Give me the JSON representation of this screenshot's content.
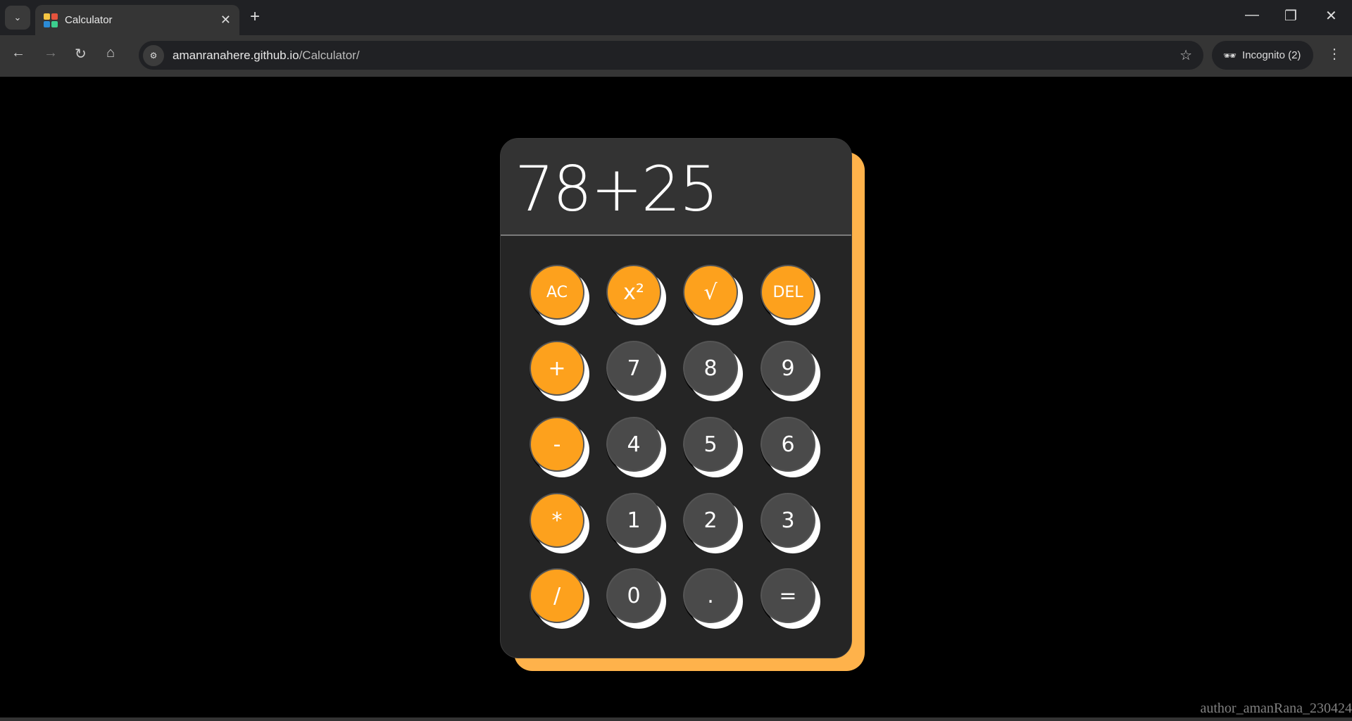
{
  "browser": {
    "tab_title": "Calculator",
    "url_host": "amanranahere.github.io",
    "url_path": "/Calculator/",
    "incognito_label": "Incognito (2)"
  },
  "calculator": {
    "display": "78+25",
    "buttons": [
      {
        "label": "AC",
        "type": "operator"
      },
      {
        "label": "x²",
        "type": "operator"
      },
      {
        "label": "√",
        "type": "operator"
      },
      {
        "label": "DEL",
        "type": "operator"
      },
      {
        "label": "+",
        "type": "operator"
      },
      {
        "label": "7",
        "type": "number"
      },
      {
        "label": "8",
        "type": "number"
      },
      {
        "label": "9",
        "type": "number"
      },
      {
        "label": "-",
        "type": "operator"
      },
      {
        "label": "4",
        "type": "number"
      },
      {
        "label": "5",
        "type": "number"
      },
      {
        "label": "6",
        "type": "number"
      },
      {
        "label": "*",
        "type": "operator"
      },
      {
        "label": "1",
        "type": "number"
      },
      {
        "label": "2",
        "type": "number"
      },
      {
        "label": "3",
        "type": "number"
      },
      {
        "label": "/",
        "type": "operator"
      },
      {
        "label": "0",
        "type": "number"
      },
      {
        "label": ".",
        "type": "number"
      },
      {
        "label": "=",
        "type": "number"
      }
    ],
    "colors": {
      "operator": "#fda11d",
      "number": "#4a4a4a",
      "accent_back": "#feb24b"
    }
  },
  "footer": {
    "author": "author_amanRana_230424"
  }
}
